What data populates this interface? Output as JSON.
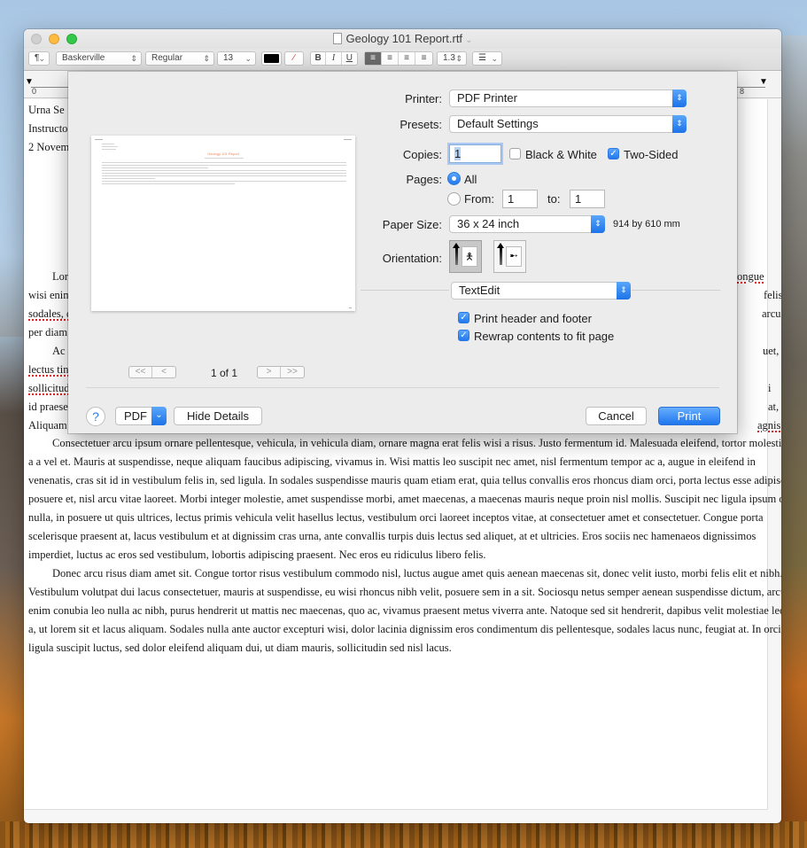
{
  "window": {
    "title": "Geology 101 Report.rtf",
    "title_chevron": "⌄"
  },
  "toolbar": {
    "paragraph_style": "¶",
    "font_family": "Baskerville",
    "font_style": "Regular",
    "font_size": "13",
    "bold": "B",
    "italic": "I",
    "underline": "U",
    "line_spacing": "1.3",
    "list_icon": "☰",
    "align_left": "≡",
    "align_center": "≡",
    "align_right": "≡",
    "align_justify": "≡"
  },
  "ruler": {
    "start_label": "0",
    "end_label": "8"
  },
  "document": {
    "header_lines": [
      "Urna Se",
      "Instructo",
      "2 Novem"
    ],
    "paragraph1": [
      "Lor",
      "wisi enim",
      "sodales, d",
      "per diam"
    ],
    "paragraph1_right": [
      "ongue",
      "felis",
      "arcu"
    ],
    "paragraph2_left": [
      "Ac",
      "lectus tin",
      "sollicitudi",
      "id praese",
      "Aliquam"
    ],
    "paragraph2_right": [
      "uet,",
      "i at,",
      "agnis."
    ],
    "paragraph3": [
      "Consectetuer arcu ipsum ornare pellentesque, vehicula, in vehicula diam, ornare magna erat felis wisi a risus. Justo fermentum id. Malesuada eleifend, tortor molestie,",
      "a a vel et. Mauris at suspendisse, neque aliquam faucibus adipiscing, vivamus in. Wisi mattis leo suscipit nec amet, nisl fermentum tempor ac a, augue in eleifend in",
      "venenatis, cras sit id in vestibulum felis in, sed ligula. In sodales suspendisse mauris quam etiam erat, quia tellus convallis eros rhoncus diam orci, porta lectus esse adipiscing",
      "posuere et, nisl arcu vitae laoreet. Morbi integer molestie, amet suspendisse morbi, amet maecenas, a maecenas mauris neque proin nisl mollis. Suscipit nec ligula ipsum orci",
      "nulla, in posuere ut quis ultrices, lectus primis vehicula velit hasellus lectus, vestibulum orci laoreet inceptos vitae, at consectetuer amet et consectetuer. Congue porta",
      "scelerisque praesent at, lacus vestibulum et at dignissim cras urna, ante convallis turpis duis lectus sed aliquet, at et ultricies. Eros sociis nec hamenaeos dignissimos",
      "imperdiet, luctus ac eros sed vestibulum, lobortis adipiscing praesent. Nec eros eu ridiculus libero felis."
    ],
    "paragraph4": [
      "Donec arcu risus diam amet sit. Congue tortor risus vestibulum commodo nisl, luctus augue amet quis aenean maecenas sit, donec velit iusto, morbi felis elit et nibh.",
      "Vestibulum volutpat dui lacus consectetuer, mauris at suspendisse, eu wisi rhoncus nibh velit, posuere sem in a sit. Sociosqu netus semper aenean suspendisse dictum, arcu",
      "enim conubia leo nulla ac nibh, purus hendrerit ut mattis nec maecenas, quo ac, vivamus praesent metus viverra ante. Natoque sed sit hendrerit, dapibus velit molestiae leo",
      "a, ut lorem sit et lacus aliquam. Sodales nulla ante auctor excepturi wisi, dolor lacinia dignissim eros condimentum dis pellentesque, sodales lacus nunc, feugiat at. In orci",
      "ligula suscipit luctus, sed dolor eleifend aliquam dui, ut diam mauris, sollicitudin sed nisl lacus."
    ]
  },
  "print_dialog": {
    "preview": {
      "title": "Geology 101 Report",
      "page_count": "1 of 1",
      "first_page": "<<",
      "prev_page": "<",
      "next_page": ">",
      "last_page": ">>"
    },
    "printer_label": "Printer:",
    "printer_value": "PDF Printer",
    "presets_label": "Presets:",
    "presets_value": "Default Settings",
    "copies_label": "Copies:",
    "copies_value": "1",
    "black_white_label": "Black & White",
    "black_white_checked": false,
    "two_sided_label": "Two-Sided",
    "two_sided_checked": true,
    "pages_label": "Pages:",
    "pages_all_label": "All",
    "pages_from_label": "From:",
    "pages_from_value": "1",
    "pages_to_label": "to:",
    "pages_to_value": "1",
    "paper_size_label": "Paper Size:",
    "paper_size_value": "36 x 24 inch",
    "paper_size_mm": "914 by 610 mm",
    "orientation_label": "Orientation:",
    "orientation_selected": "portrait",
    "app_section_value": "TextEdit",
    "print_header_footer_label": "Print header and footer",
    "print_header_footer_checked": true,
    "rewrap_label": "Rewrap contents to fit page",
    "rewrap_checked": true,
    "help_label": "?",
    "pdf_label": "PDF",
    "hide_details_label": "Hide Details",
    "cancel_label": "Cancel",
    "print_label": "Print",
    "checkmark": "✓",
    "updown_arrows": "⌃⌄",
    "dropdown_chevron": "⌄"
  },
  "colors": {
    "accent": "#1f76ee",
    "spell_underline": "#e02020",
    "preview_title": "#f08a60"
  }
}
